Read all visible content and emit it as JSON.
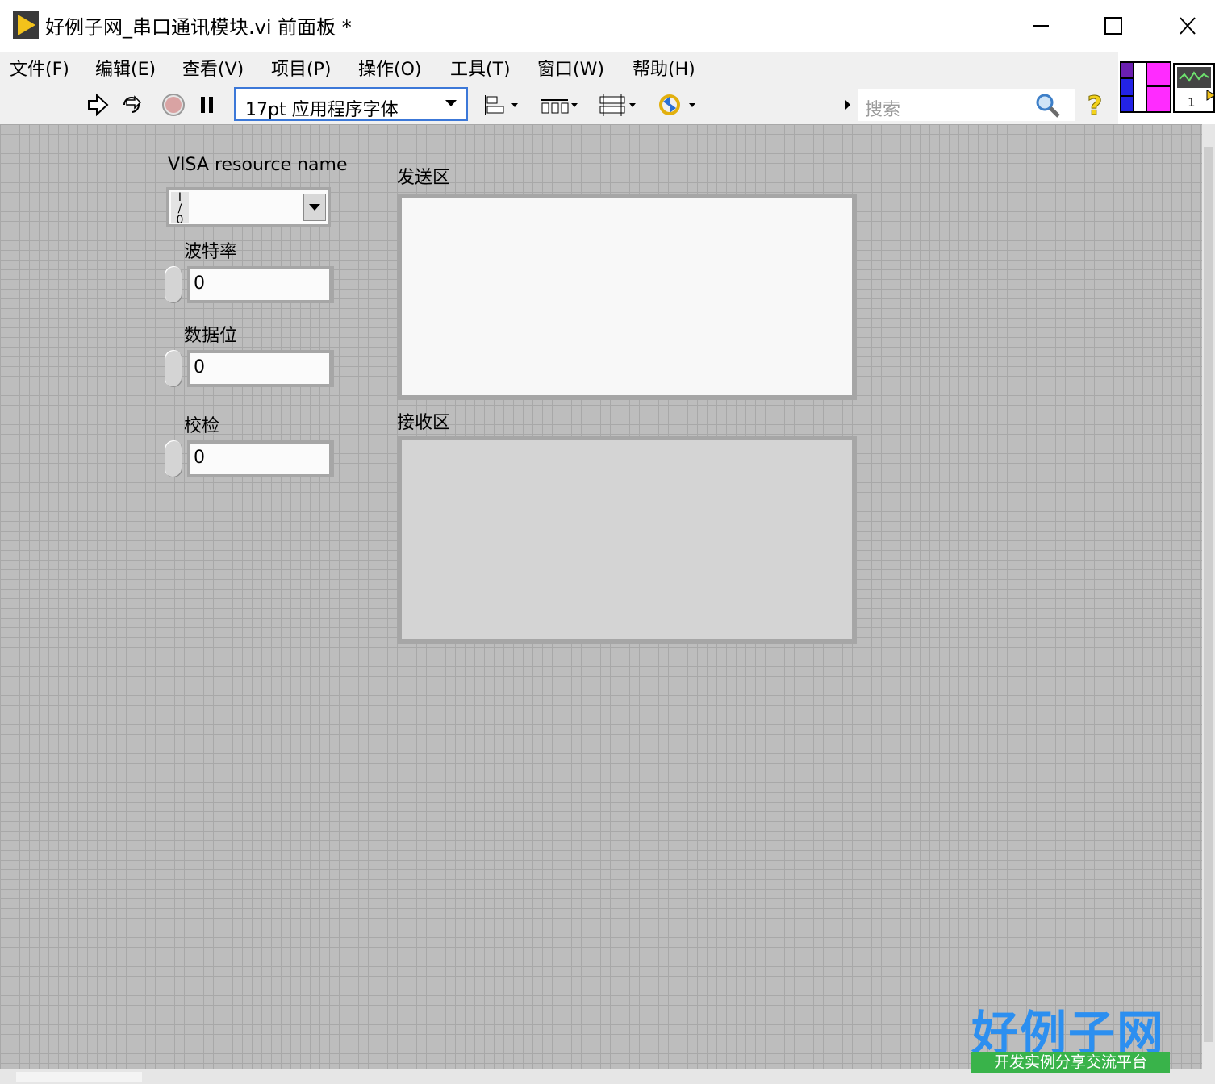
{
  "window": {
    "title": "好例子网_串口通讯模块.vi 前面板 *"
  },
  "menu": {
    "items": [
      "文件(F)",
      "编辑(E)",
      "查看(V)",
      "项目(P)",
      "操作(O)",
      "工具(T)",
      "窗口(W)",
      "帮助(H)"
    ]
  },
  "toolbar": {
    "font": "17pt 应用程序字体",
    "search_placeholder": "搜索"
  },
  "connector": {
    "terminal_label": "1"
  },
  "controls": {
    "visa_label": "VISA resource name",
    "visa_value": "",
    "baud_label": "波特率",
    "baud_value": "0",
    "databits_label": "数据位",
    "databits_value": "0",
    "parity_label": "校检",
    "parity_value": "0",
    "send_label": "发送区",
    "send_value": "",
    "receive_label": "接收区",
    "receive_value": ""
  },
  "watermark": {
    "site": "好例子网",
    "slogan": "开发实例分享交流平台"
  },
  "colors": {
    "panel_bg": "#bdbdbd",
    "grid": "#a8a8a8",
    "selection_border": "#3c78d8",
    "watermark_blue": "#2c8ff0",
    "watermark_green": "#39b34a"
  }
}
